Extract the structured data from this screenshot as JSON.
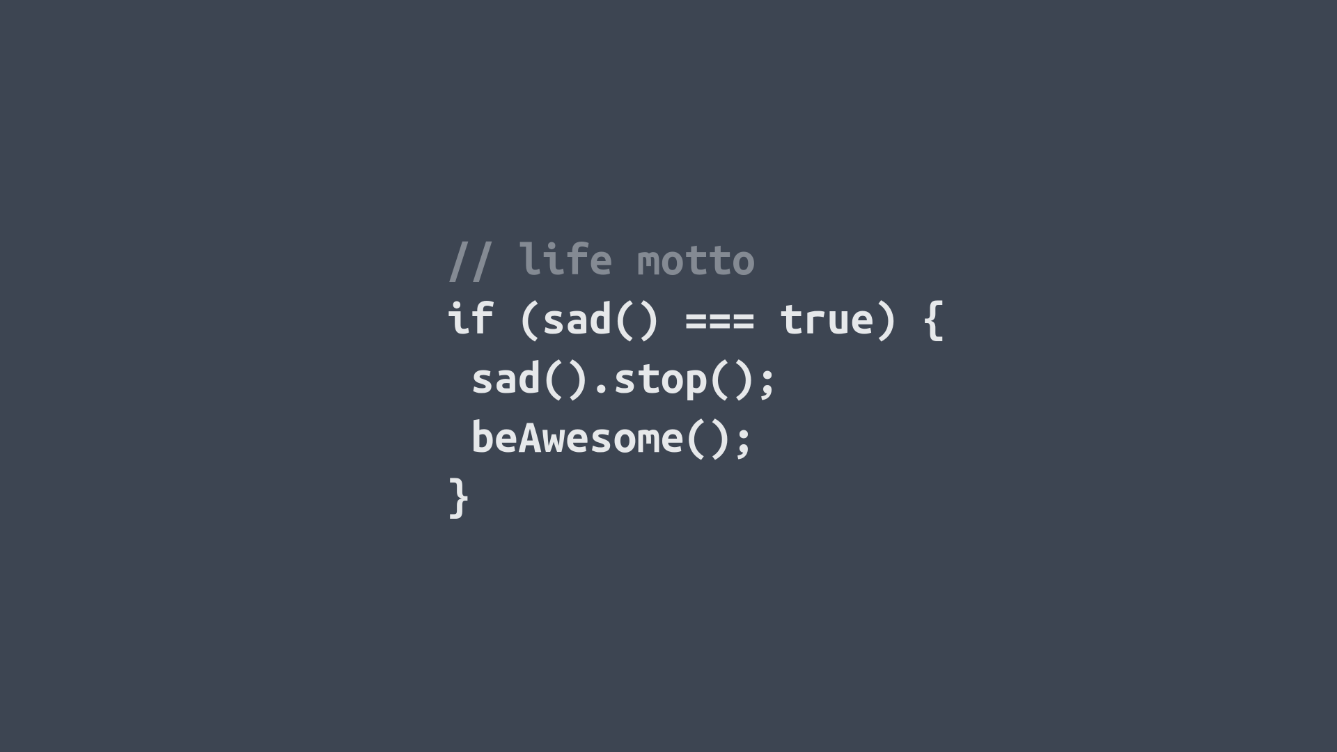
{
  "code": {
    "line1": "// life motto",
    "line2": "if (sad() === true) {",
    "line3": " sad().stop();",
    "line4": " beAwesome();",
    "line5": "}"
  },
  "colors": {
    "background": "#3d4552",
    "comment": "#848a93",
    "code": "#e6e8ea"
  }
}
